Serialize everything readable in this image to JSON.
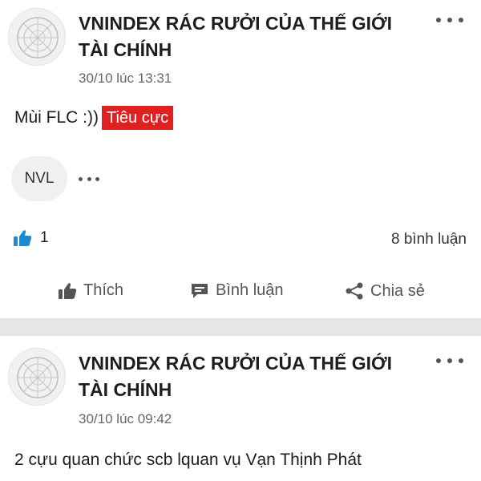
{
  "posts": [
    {
      "group_title": "VNINDEX RÁC RƯỞI CỦA THẾ GIỚI TÀI CHÍNH",
      "timestamp": "30/10 lúc 13:31",
      "body": "Mùi FLC :))",
      "sentiment_badge": "Tiêu cực",
      "tag_chip": "NVL",
      "like_count": "1",
      "comment_count": "8 bình luận",
      "actions": {
        "like": "Thích",
        "comment": "Bình luận",
        "share": "Chia sẻ"
      }
    },
    {
      "group_title": "VNINDEX RÁC RƯỞI CỦA THẾ GIỚI TÀI CHÍNH",
      "timestamp": "30/10 lúc 09:42",
      "body": "2 cựu quan chức scb lquan vụ Vạn Thịnh Phát"
    }
  ],
  "colors": {
    "badge_bg": "#e02121",
    "like_icon": "#1a8ad4",
    "divider": "#e6e6e6"
  },
  "icons": [
    "avatar-logo",
    "more-options-icon",
    "thumbs-up-icon",
    "comment-icon",
    "share-icon"
  ]
}
